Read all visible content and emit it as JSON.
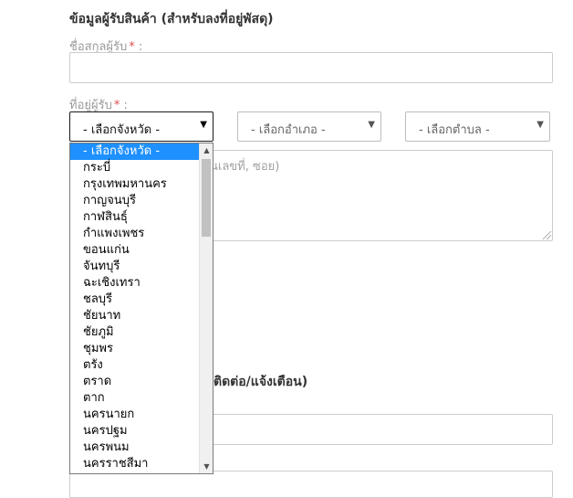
{
  "section_title": "ข้อมูลผู้รับสินค้า (สำหรับลงที่อยู่พัสดุ)",
  "name_label": "ชื่อสกุลผู้รับ",
  "address_label": "ที่อยู่ผู้รับ",
  "required_mark": "*",
  "label_suffix": " :",
  "province_select": "- เลือกจังหวัด -",
  "district_select": "- เลือกอำเภอ -",
  "subdistrict_select": "- เลือกตำบล -",
  "address_placeholder_visible": "นเลขที่, ซอย)",
  "section2_title_visible": "ติดต่อ/แจ้งเตือน)",
  "caret": "▼",
  "province_options": [
    "- เลือกจังหวัด -",
    "กระบี่",
    "กรุงเทพมหานคร",
    "กาญจนบุรี",
    "กาฬสินธุ์",
    "กำแพงเพชร",
    "ขอนแก่น",
    "จันทบุรี",
    "ฉะเชิงเทรา",
    "ชลบุรี",
    "ชัยนาท",
    "ชัยภูมิ",
    "ชุมพร",
    "ตรัง",
    "ตราด",
    "ตาก",
    "นครนายก",
    "นครปฐม",
    "นครพนม",
    "นครราชสีมา"
  ],
  "selected_option_index": 0
}
